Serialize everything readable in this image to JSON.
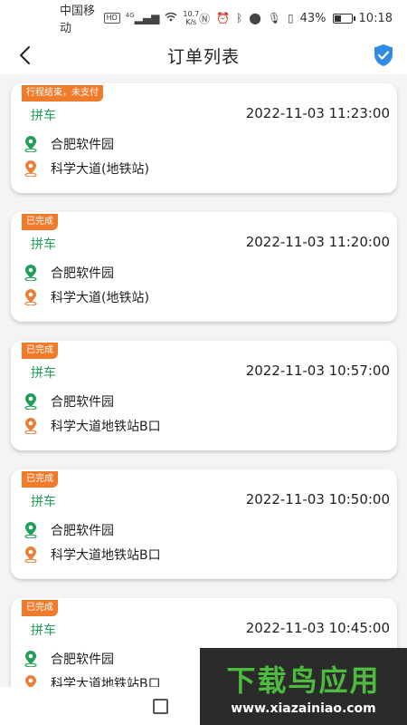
{
  "status_bar": {
    "carrier": "中国移动",
    "hd": "HD",
    "network": "4G",
    "speed_value": "10.7",
    "speed_unit": "K/s",
    "battery_text": "43%",
    "battery_level": 0.43,
    "time": "10:18"
  },
  "header": {
    "title": "订单列表"
  },
  "orders": [
    {
      "status": "行程结束，未支付",
      "type": "拼车",
      "time": "2022-11-03 11:23:00",
      "start": "合肥软件园",
      "end": "科学大道(地铁站)"
    },
    {
      "status": "已完成",
      "type": "拼车",
      "time": "2022-11-03 11:20:00",
      "start": "合肥软件园",
      "end": "科学大道(地铁站)"
    },
    {
      "status": "已完成",
      "type": "拼车",
      "time": "2022-11-03 10:57:00",
      "start": "合肥软件园",
      "end": "科学大道地铁站B口"
    },
    {
      "status": "已完成",
      "type": "拼车",
      "time": "2022-11-03 10:50:00",
      "start": "合肥软件园",
      "end": "科学大道地铁站B口"
    },
    {
      "status": "已完成",
      "type": "拼车",
      "time": "2022-11-03 10:45:00",
      "start": "合肥软件园",
      "end": "科学大道地铁站B口"
    }
  ],
  "icons": {
    "back": "chevron-left-icon",
    "shield": "shield-check-icon",
    "start_pin": "start-location-icon",
    "end_pin": "end-location-icon"
  },
  "colors": {
    "status_tag": "#f07b2b",
    "type_label": "#1e9e57",
    "start_pin": "#1e9e57",
    "end_pin": "#e8803a",
    "shield": "#2f8be6"
  },
  "watermark": {
    "main": "下载鸟应用",
    "sub": "www.xiazainiao.com"
  }
}
